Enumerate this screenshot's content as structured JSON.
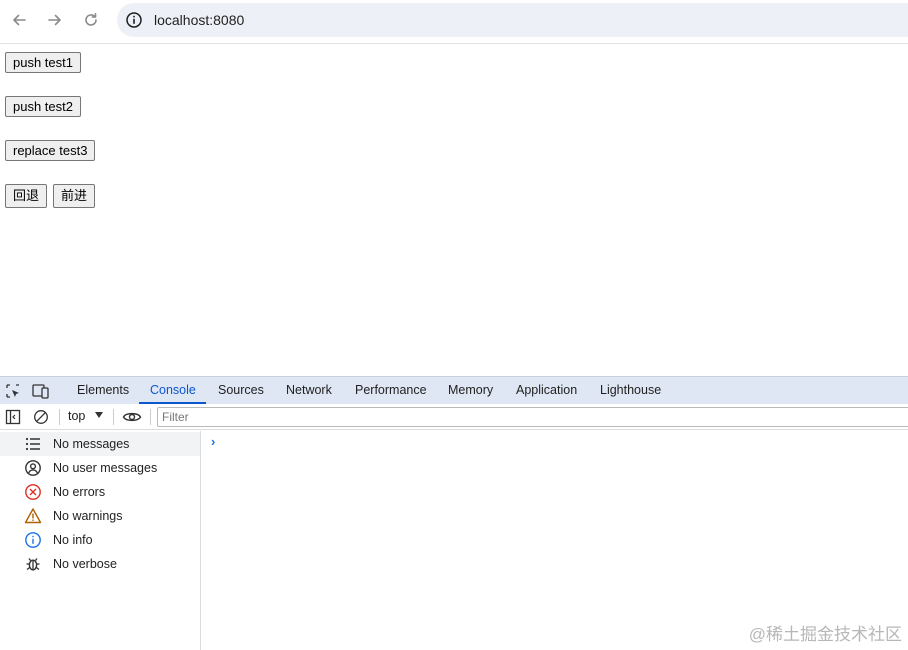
{
  "browser": {
    "url": "localhost:8080",
    "icons": {
      "back": "arrow-left-icon",
      "forward": "arrow-right-icon",
      "reload": "reload-icon",
      "site_info": "info-icon"
    }
  },
  "page": {
    "buttons": {
      "push_test1": "push test1",
      "push_test2": "push test2",
      "replace_test3": "replace test3",
      "back": "回退",
      "forward": "前进"
    }
  },
  "devtools": {
    "tabs": [
      "Elements",
      "Console",
      "Sources",
      "Network",
      "Performance",
      "Memory",
      "Application",
      "Lighthouse"
    ],
    "active_tab": "Console",
    "context": "top",
    "filter_placeholder": "Filter",
    "sidebar": [
      {
        "label": "No messages",
        "icon": "list-icon"
      },
      {
        "label": "No user messages",
        "icon": "user-icon"
      },
      {
        "label": "No errors",
        "icon": "error-icon"
      },
      {
        "label": "No warnings",
        "icon": "warning-icon"
      },
      {
        "label": "No info",
        "icon": "info-icon"
      },
      {
        "label": "No verbose",
        "icon": "bug-icon"
      }
    ],
    "prompt": "›",
    "colors": {
      "accent": "#0b57d0",
      "tab_bar": "#dfe7f4",
      "error": "#d93025",
      "warning": "#b06000",
      "info": "#1a73e8"
    }
  },
  "watermark": "@稀土掘金技术社区"
}
